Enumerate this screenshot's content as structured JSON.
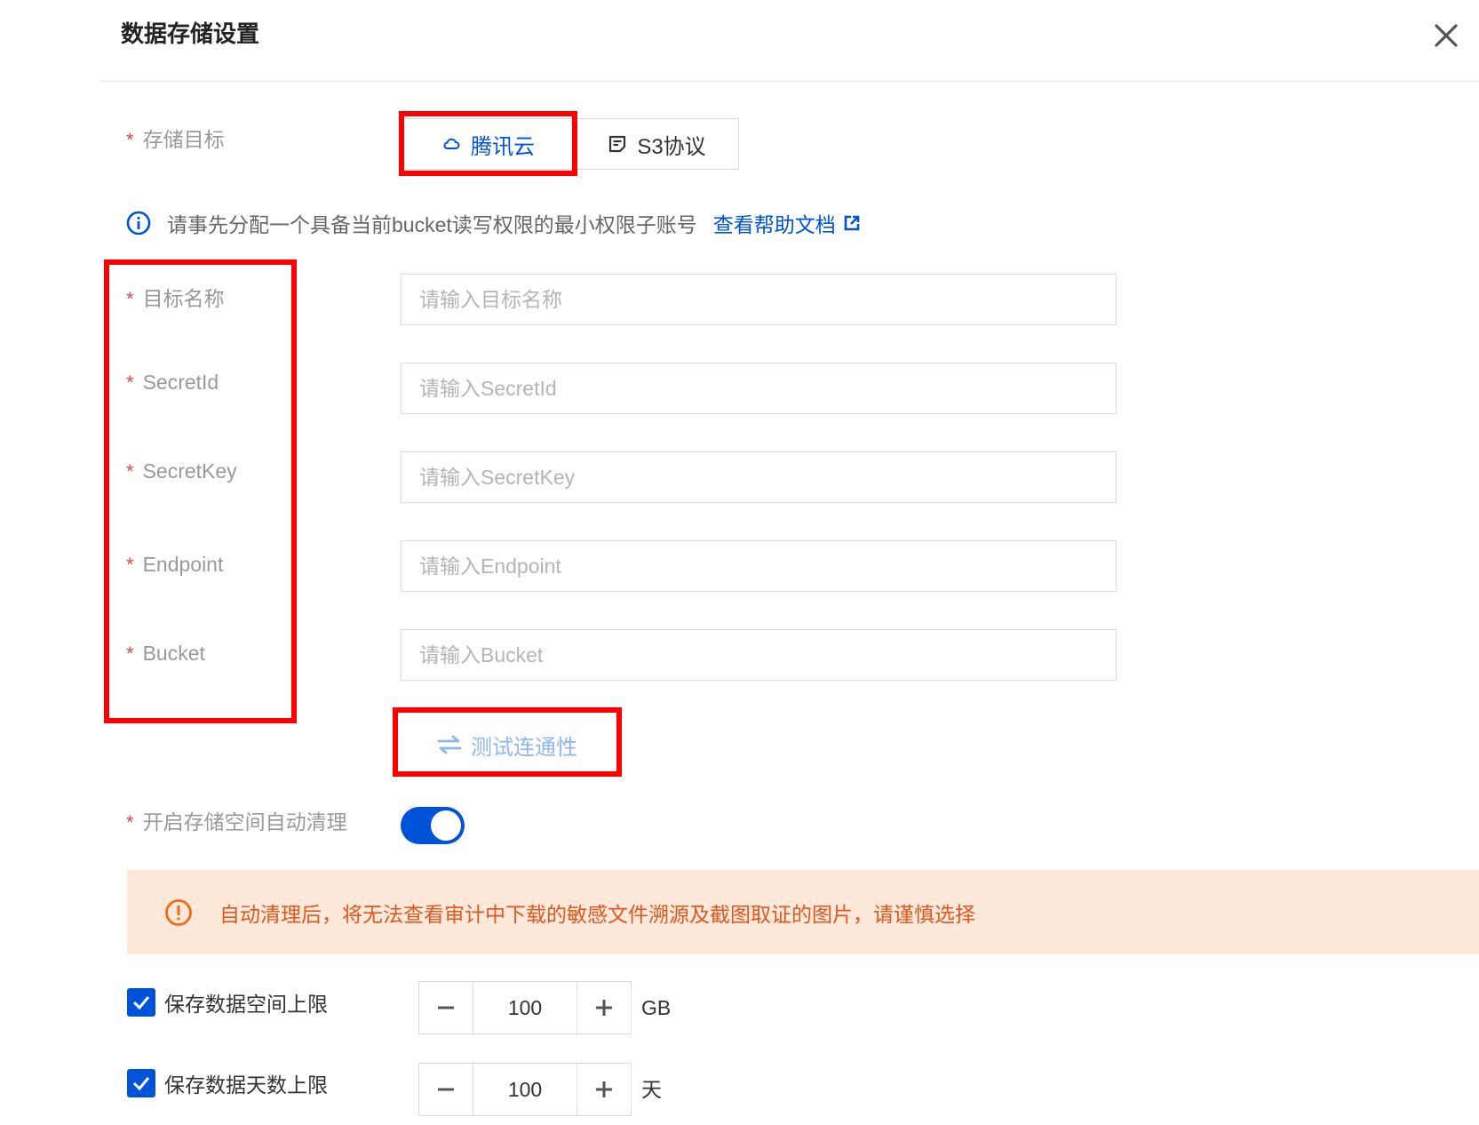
{
  "dialog": {
    "title": "数据存储设置"
  },
  "storage_target": {
    "label": "存储目标",
    "options": [
      {
        "label": "腾讯云",
        "icon": "tencent-cloud-icon",
        "selected": true
      },
      {
        "label": "S3协议",
        "icon": "s3-doc-icon",
        "selected": false
      }
    ]
  },
  "tip": {
    "text": "请事先分配一个具备当前bucket读写权限的最小权限子账号",
    "link": "查看帮助文档"
  },
  "fields": [
    {
      "label": "目标名称",
      "placeholder": "请输入目标名称"
    },
    {
      "label": "SecretId",
      "placeholder": "请输入SecretId"
    },
    {
      "label": "SecretKey",
      "placeholder": "请输入SecretKey"
    },
    {
      "label": "Endpoint",
      "placeholder": "请输入Endpoint"
    },
    {
      "label": "Bucket",
      "placeholder": "请输入Bucket"
    }
  ],
  "test_button": {
    "label": "测试连通性"
  },
  "auto_clean": {
    "label": "开启存储空间自动清理",
    "enabled": true
  },
  "warning": {
    "text": "自动清理后，将无法查看审计中下载的敏感文件溯源及截图取证的图片，请谨慎选择"
  },
  "limits": [
    {
      "label": "保存数据空间上限",
      "checked": true,
      "value": "100",
      "unit": "GB"
    },
    {
      "label": "保存数据天数上限",
      "checked": true,
      "value": "100",
      "unit": "天"
    }
  ],
  "colors": {
    "primary": "#0052d9",
    "required": "#e54545",
    "warning_bg": "#fde8da",
    "warning_text": "#e0581f",
    "annotation": "#ff0000"
  }
}
